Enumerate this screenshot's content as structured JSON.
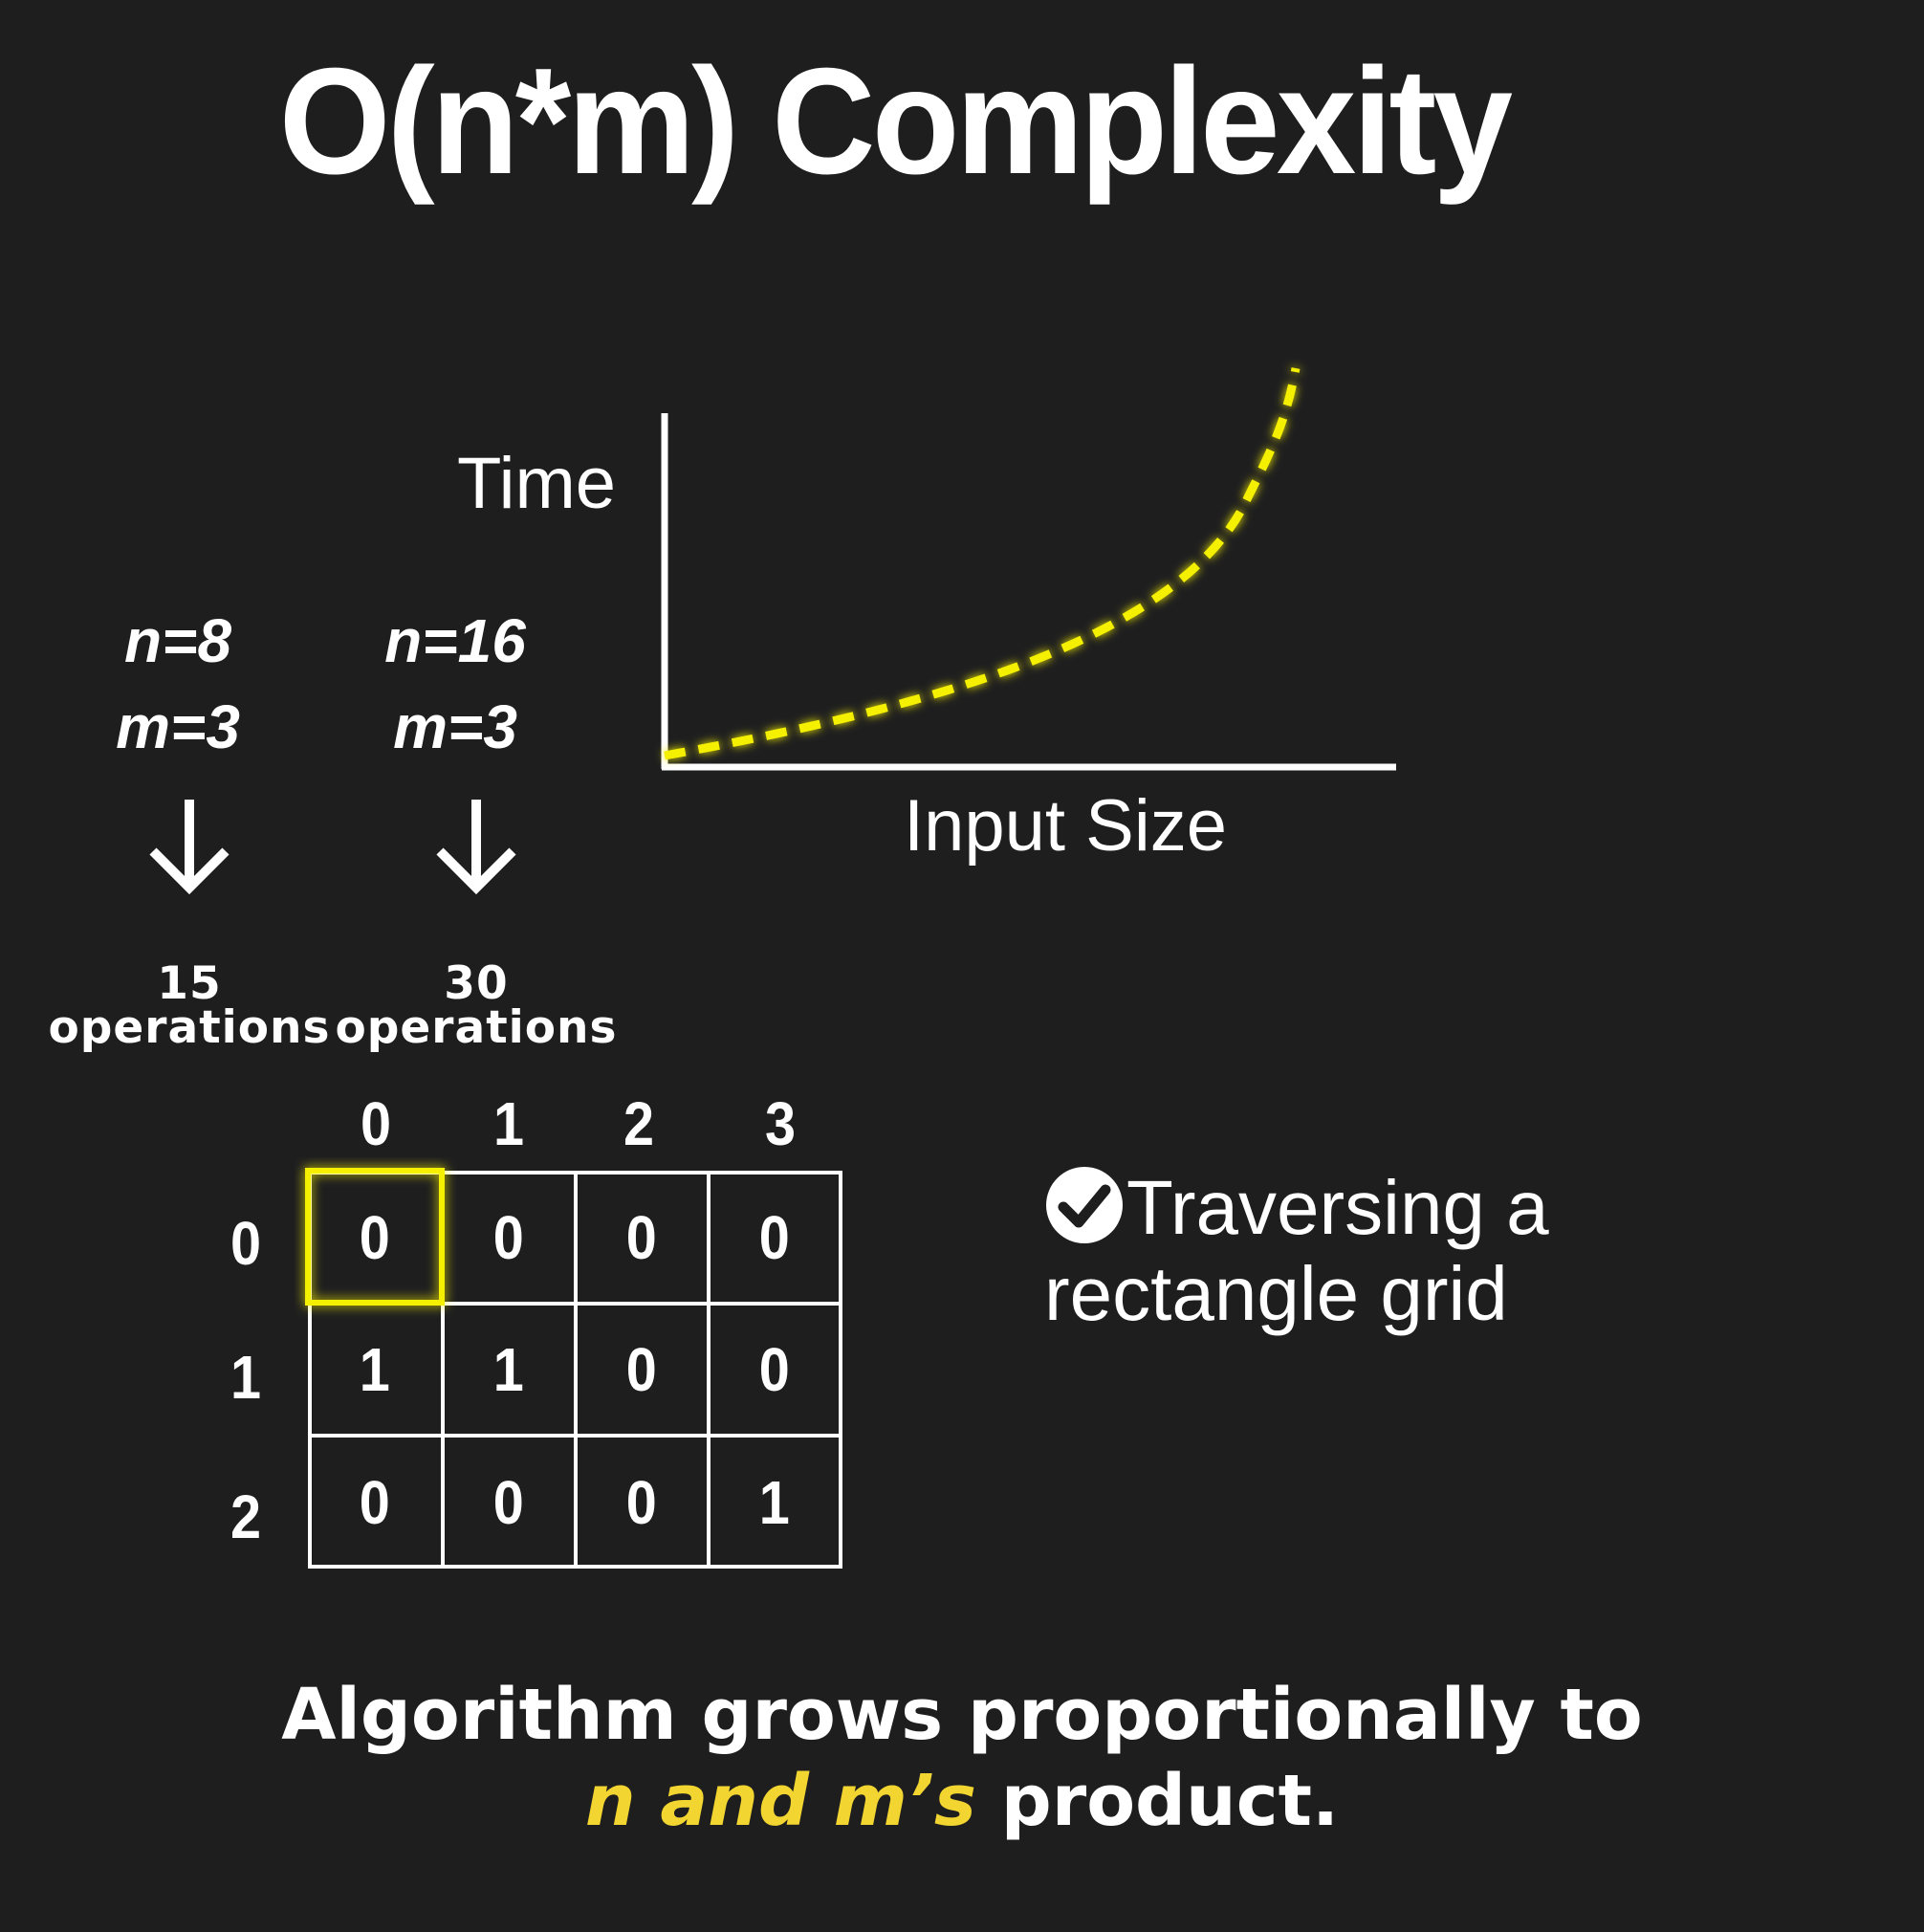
{
  "title": "O(n*m) Complexity",
  "graph": {
    "y_label": "Time",
    "x_label": "Input Size",
    "curve_color": "#f5f000",
    "curve_style": "dashed"
  },
  "examples": [
    {
      "n": "n=8",
      "m": "m=3",
      "arrow": "down-arrow-icon",
      "ops_count": "15",
      "ops_label": "operations"
    },
    {
      "n": "n=16",
      "m": "m=3",
      "arrow": "down-arrow-icon",
      "ops_count": "30",
      "ops_label": "operations"
    }
  ],
  "grid": {
    "column_indices": [
      "0",
      "1",
      "2",
      "3"
    ],
    "row_indices": [
      "0",
      "1",
      "2"
    ],
    "rows": [
      [
        "0",
        "0",
        "0",
        "0"
      ],
      [
        "1",
        "1",
        "0",
        "0"
      ],
      [
        "0",
        "0",
        "0",
        "1"
      ]
    ],
    "highlight_color": "#f5f000",
    "highlighted_cell": {
      "row": 0,
      "col": 0
    }
  },
  "note": {
    "icon": "check-circle-icon",
    "line1": "Traversing a",
    "line2": "rectangle grid"
  },
  "summary": {
    "line1": "Algorithm grows proportionally to",
    "highlight": "n and m’s",
    "rest": " product.",
    "highlight_color": "#f2d530"
  }
}
